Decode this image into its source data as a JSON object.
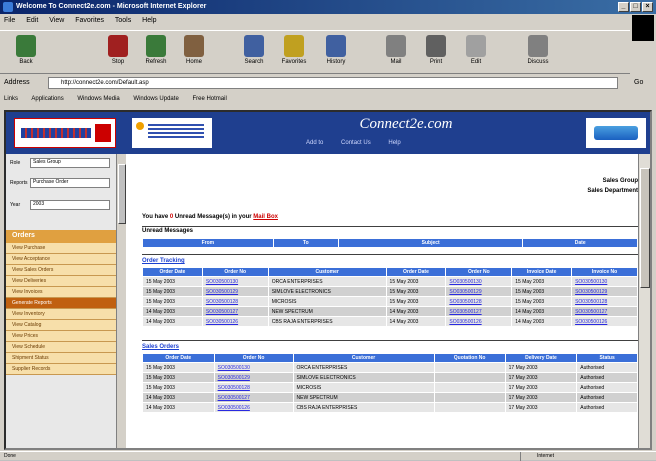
{
  "window": {
    "title": "Welcome To Connect2e.com - Microsoft Internet Explorer",
    "controls": [
      "_",
      "□",
      "×"
    ]
  },
  "menu": [
    "File",
    "Edit",
    "View",
    "Favorites",
    "Tools",
    "Help"
  ],
  "toolbar": [
    {
      "label": "Back",
      "icon": "back-arrow-icon",
      "color": "#3a7a3a"
    },
    {
      "label": "Stop",
      "icon": "stop-icon",
      "color": "#a02020"
    },
    {
      "label": "Refresh",
      "icon": "refresh-icon",
      "color": "#3a7a3a"
    },
    {
      "label": "Home",
      "icon": "home-icon",
      "color": "#806040"
    },
    {
      "label": "Search",
      "icon": "search-icon",
      "color": "#4060a0"
    },
    {
      "label": "Favorites",
      "icon": "favorites-icon",
      "color": "#c0a020"
    },
    {
      "label": "History",
      "icon": "history-icon",
      "color": "#4060a0"
    },
    {
      "label": "Mail",
      "icon": "mail-icon",
      "color": "#808080"
    },
    {
      "label": "Print",
      "icon": "print-icon",
      "color": "#606060"
    },
    {
      "label": "Edit",
      "icon": "edit-icon",
      "color": "#a0a0a0"
    },
    {
      "label": "Discuss",
      "icon": "discuss-icon",
      "color": "#808080"
    }
  ],
  "address": {
    "label": "Address",
    "value": "http://connect2e.com/Default.asp",
    "go": "Go"
  },
  "links": {
    "label": "Links",
    "items": [
      "Applications",
      "Windows Media",
      "Windows Update",
      "Free Hotmail"
    ]
  },
  "site": {
    "brand": "Connect2e.com",
    "nav": [
      "Add to",
      "Contact Us",
      "Help"
    ]
  },
  "sidebar": {
    "fields": [
      {
        "label": "Role",
        "value": "Sales Group"
      },
      {
        "label": "Reports",
        "value": "Purchase Order"
      },
      {
        "label": "Year",
        "value": "2003"
      }
    ],
    "menu_head": "Orders",
    "menu": [
      {
        "label": "View Purchase",
        "dark": false
      },
      {
        "label": "View Acceptance",
        "dark": false
      },
      {
        "label": "View Sales Orders",
        "dark": false
      },
      {
        "label": "View Deliveries",
        "dark": false
      },
      {
        "label": "View Invoices",
        "dark": false
      },
      {
        "label": "Generate Reports",
        "dark": true
      },
      {
        "label": "View Inventory",
        "dark": false
      },
      {
        "label": "View Catalog",
        "dark": false
      },
      {
        "label": "View Prices",
        "dark": false
      },
      {
        "label": "View Schedule",
        "dark": false
      },
      {
        "label": "Shipment Status",
        "dark": false
      },
      {
        "label": "Supplier Records",
        "dark": false
      }
    ]
  },
  "main": {
    "user_name": "Sales Group",
    "user_dept": "Sales Department",
    "greeting_prefix": "You have",
    "message_count": "0",
    "greeting_suffix": "Unread Message(s) in your",
    "greeting_link": "Mail Box",
    "messages": {
      "title": "Unread Messages",
      "columns": [
        "From",
        "To",
        "Subject",
        "Date"
      ]
    },
    "orders": {
      "title": "Order Tracking",
      "columns": [
        "Order Date",
        "Order No",
        "Customer",
        "Order Date",
        "Order No",
        "Invoice Date",
        "Invoice No"
      ],
      "rows": [
        [
          "15 May 2003",
          "SO030500130",
          "ORCA ENTERPRISES",
          "15 May 2003",
          "SO030500130",
          "15 May 2003",
          "SO030500130"
        ],
        [
          "15 May 2003",
          "SO030500129",
          "SIMLOVE ELECTRONICS",
          "15 May 2003",
          "SO030500129",
          "15 May 2003",
          "SO030500129"
        ],
        [
          "15 May 2003",
          "SO030500128",
          "MICROSIS",
          "15 May 2003",
          "SO030500128",
          "15 May 2003",
          "SO030500128"
        ],
        [
          "14 May 2003",
          "SO030500127",
          "NEW SPECTRUM",
          "14 May 2003",
          "SO030500127",
          "14 May 2003",
          "SO030500127"
        ],
        [
          "14 May 2003",
          "SO030500126",
          "CBS RAJA ENTERPRISES",
          "14 May 2003",
          "SO030500126",
          "14 May 2003",
          "SO030500126"
        ]
      ]
    },
    "sales": {
      "title": "Sales Orders",
      "columns": [
        "Order Date",
        "Order No",
        "Customer",
        "Quotation No",
        "Delivery Date",
        "Status"
      ],
      "rows": [
        [
          "15 May 2003",
          "SO030500130",
          "ORCA ENTERPRISES",
          "",
          "17 May 2003",
          "Authorised"
        ],
        [
          "15 May 2003",
          "SO030500129",
          "SIMLOVE ELECTRONICS",
          "",
          "17 May 2003",
          "Authorised"
        ],
        [
          "15 May 2003",
          "SO030500128",
          "MICROSIS",
          "",
          "17 May 2003",
          "Authorised"
        ],
        [
          "14 May 2003",
          "SO030500127",
          "NEW SPECTRUM",
          "",
          "17 May 2003",
          "Authorised"
        ],
        [
          "14 May 2003",
          "SO030500126",
          "CBS RAJA ENTERPRISES",
          "",
          "17 May 2003",
          "Authorised"
        ]
      ]
    }
  },
  "status": {
    "text": "Done",
    "zone": "Internet"
  }
}
